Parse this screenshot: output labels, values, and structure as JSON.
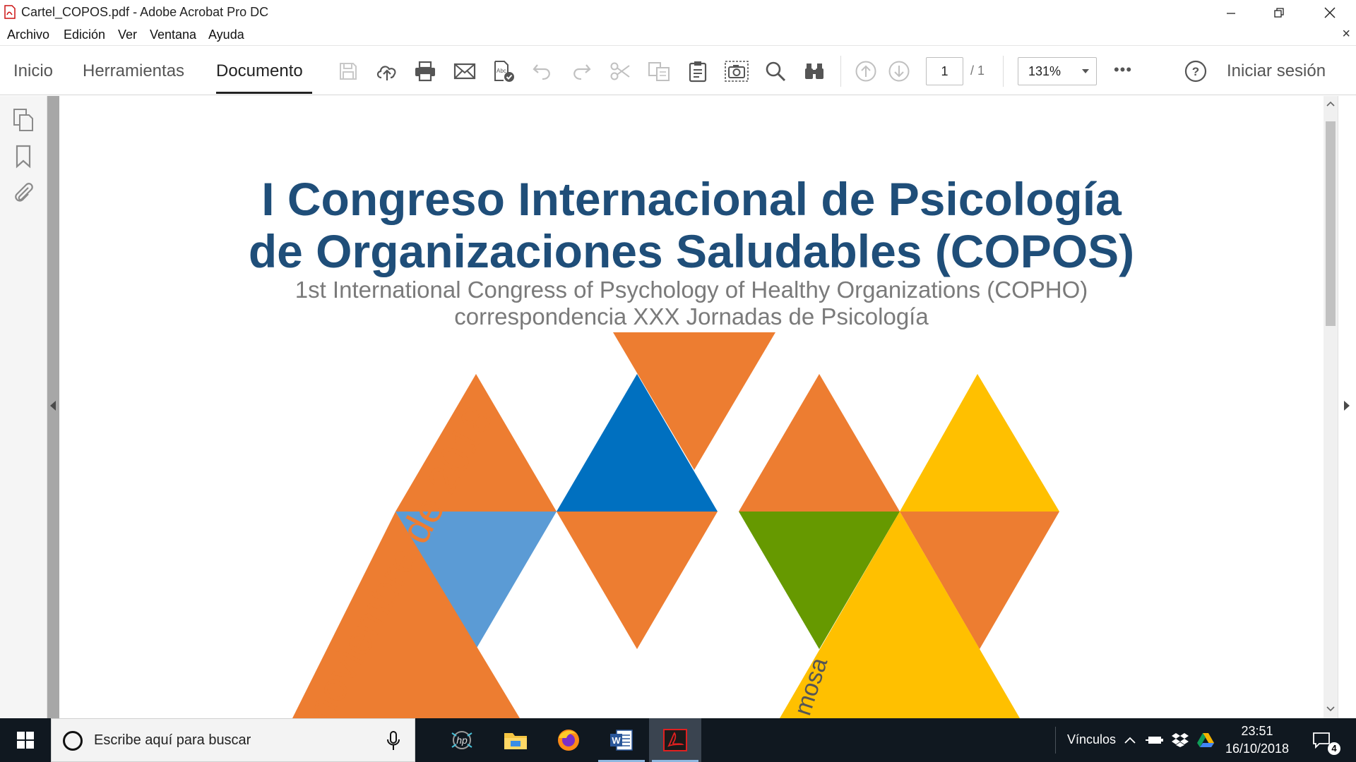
{
  "window": {
    "title": "Cartel_COPOS.pdf - Adobe Acrobat Pro DC"
  },
  "menu": {
    "items": [
      "Archivo",
      "Edición",
      "Ver",
      "Ventana",
      "Ayuda"
    ],
    "close_glyph": "×"
  },
  "toolbar": {
    "tabs": [
      "Inicio",
      "Herramientas",
      "Documento"
    ],
    "active_tab": "Documento",
    "page_current": "1",
    "page_total": "/ 1",
    "zoom": "131%",
    "more": "•••",
    "help_glyph": "?",
    "signin": "Iniciar sesión"
  },
  "document": {
    "title_line1": "I Congreso Internacional de Psicología",
    "title_line2": "de Organizaciones Saludables (COPOS)",
    "subtitle_line1": "1st International Congress of Psychology of Healthy Organizations (COPHO)",
    "subtitle_line2": "correspondencia XXX Jornadas de Psicología",
    "rotated_text_main": "noviembre de 2018",
    "rotated_text_partial": "mosa",
    "colors": {
      "title": "#1f4e79",
      "orange": "#ed7d31",
      "dark_blue": "#0070c0",
      "light_blue": "#5b9bd5",
      "green": "#669900",
      "yellow": "#ffc000"
    }
  },
  "taskbar": {
    "search_placeholder": "Escribe aquí para buscar",
    "tray_label": "Vínculos",
    "time": "23:51",
    "date": "16/10/2018",
    "notification_count": "4"
  }
}
